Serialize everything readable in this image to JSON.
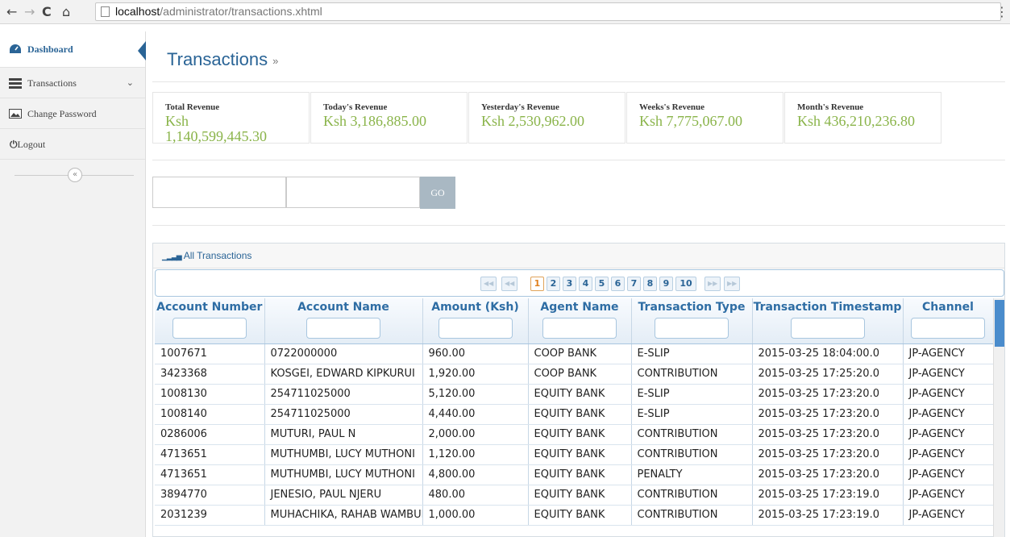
{
  "browser": {
    "url_host": "localhost",
    "url_path": "/administrator/transactions.xhtml"
  },
  "sidebar": {
    "items": [
      {
        "label": "Dashboard",
        "icon": "dashboard-icon"
      },
      {
        "label": "Transactions",
        "icon": "list-icon"
      },
      {
        "label": "Change Password",
        "icon": "image-icon"
      },
      {
        "label": "Logout",
        "icon": "power-icon"
      }
    ]
  },
  "page": {
    "title": "Transactions",
    "title_suffix": "»"
  },
  "stats": [
    {
      "label": "Total Revenue",
      "value": "Ksh 1,140,599,445.30"
    },
    {
      "label": "Today's Revenue",
      "value": "Ksh 3,186,885.00"
    },
    {
      "label": "Yesterday's Revenue",
      "value": "Ksh 2,530,962.00"
    },
    {
      "label": "Weeks's Revenue",
      "value": "Ksh 7,775,067.00"
    },
    {
      "label": "Month's Revenue",
      "value": "Ksh 436,210,236.80"
    }
  ],
  "filter": {
    "go_label": "GO"
  },
  "panel": {
    "title": "All Transactions"
  },
  "paginator": {
    "pages": [
      "1",
      "2",
      "3",
      "4",
      "5",
      "6",
      "7",
      "8",
      "9",
      "10"
    ],
    "current": "1"
  },
  "table": {
    "columns": [
      "Account Number",
      "Account Name",
      "Amount (Ksh)",
      "Agent Name",
      "Transaction Type",
      "Transaction Timestamp",
      "Channel"
    ],
    "rows": [
      [
        "1007671",
        "0722000000",
        "960.00",
        "COOP BANK",
        "E-SLIP",
        "2015-03-25 18:04:00.0",
        "JP-AGENCY"
      ],
      [
        "3423368",
        "KOSGEI, EDWARD KIPKURUI",
        "1,920.00",
        "COOP BANK",
        "CONTRIBUTION",
        "2015-03-25 17:25:20.0",
        "JP-AGENCY"
      ],
      [
        "1008130",
        "254711025000",
        "5,120.00",
        "EQUITY BANK",
        "E-SLIP",
        "2015-03-25 17:23:20.0",
        "JP-AGENCY"
      ],
      [
        "1008140",
        "254711025000",
        "4,440.00",
        "EQUITY BANK",
        "E-SLIP",
        "2015-03-25 17:23:20.0",
        "JP-AGENCY"
      ],
      [
        "0286006",
        "MUTURI, PAUL N",
        "2,000.00",
        "EQUITY BANK",
        "CONTRIBUTION",
        "2015-03-25 17:23:20.0",
        "JP-AGENCY"
      ],
      [
        "4713651",
        "MUTHUMBI, LUCY MUTHONI",
        "1,120.00",
        "EQUITY BANK",
        "CONTRIBUTION",
        "2015-03-25 17:23:20.0",
        "JP-AGENCY"
      ],
      [
        "4713651",
        "MUTHUMBI, LUCY MUTHONI",
        "4,800.00",
        "EQUITY BANK",
        "PENALTY",
        "2015-03-25 17:23:20.0",
        "JP-AGENCY"
      ],
      [
        "3894770",
        "JENESIO, PAUL NJERU",
        "480.00",
        "EQUITY BANK",
        "CONTRIBUTION",
        "2015-03-25 17:23:19.0",
        "JP-AGENCY"
      ],
      [
        "2031239",
        "MUHACHIKA, RAHAB WAMBUI",
        "1,000.00",
        "EQUITY BANK",
        "CONTRIBUTION",
        "2015-03-25 17:23:19.0",
        "JP-AGENCY"
      ]
    ]
  }
}
